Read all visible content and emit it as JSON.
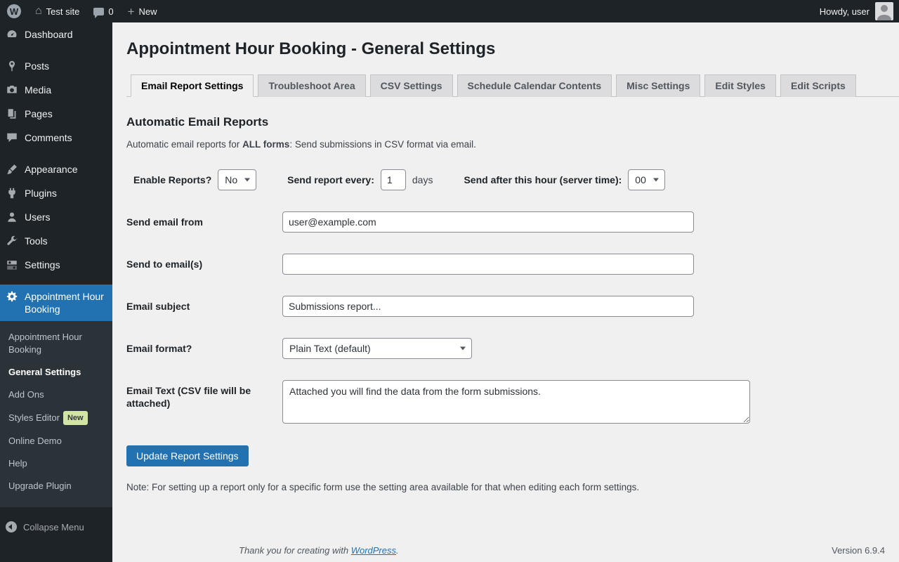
{
  "colors": {
    "accent": "#2271b1",
    "admin_bar_bg": "#1d2327",
    "sidebar_bg": "#1d2327",
    "submenu_bg": "#2c3338",
    "badge_bg": "#d3e5a4",
    "content_bg": "#f0f0f1"
  },
  "admin_bar": {
    "site_name": "Test site",
    "comments_count": "0",
    "new_label": "New",
    "howdy": "Howdy, user"
  },
  "sidebar": {
    "items": [
      {
        "label": "Dashboard",
        "icon": "dashboard-icon"
      },
      {
        "label": "Posts",
        "icon": "posts-pin-icon"
      },
      {
        "label": "Media",
        "icon": "media-camera-icon"
      },
      {
        "label": "Pages",
        "icon": "pages-icon"
      },
      {
        "label": "Comments",
        "icon": "comments-icon"
      },
      {
        "label": "Appearance",
        "icon": "appearance-brush-icon"
      },
      {
        "label": "Plugins",
        "icon": "plugins-plug-icon"
      },
      {
        "label": "Users",
        "icon": "users-icon"
      },
      {
        "label": "Tools",
        "icon": "tools-wrench-icon"
      },
      {
        "label": "Settings",
        "icon": "settings-sliders-icon"
      },
      {
        "label": "Appointment Hour Booking",
        "icon": "gear-icon",
        "active": true
      }
    ],
    "submenu": [
      {
        "label": "Appointment Hour Booking"
      },
      {
        "label": "General Settings",
        "current": true
      },
      {
        "label": "Add Ons"
      },
      {
        "label": "Styles Editor",
        "badge": "New"
      },
      {
        "label": "Online Demo"
      },
      {
        "label": "Help"
      },
      {
        "label": "Upgrade Plugin"
      }
    ],
    "collapse_label": "Collapse Menu"
  },
  "main": {
    "title": "Appointment Hour Booking - General Settings",
    "tabs": [
      {
        "label": "Email Report Settings",
        "active": true
      },
      {
        "label": "Troubleshoot Area"
      },
      {
        "label": "CSV Settings"
      },
      {
        "label": "Schedule Calendar Contents"
      },
      {
        "label": "Misc Settings"
      },
      {
        "label": "Edit Styles"
      },
      {
        "label": "Edit Scripts"
      }
    ],
    "section_title": "Automatic Email Reports",
    "intro": {
      "prefix": "Automatic email reports for ",
      "bold": "ALL forms",
      "suffix": ": Send submissions in CSV format via email."
    },
    "form": {
      "enable_reports": {
        "label": "Enable Reports?",
        "value": "No"
      },
      "send_every": {
        "label": "Send report every:",
        "value": "1",
        "suffix": "days"
      },
      "send_after": {
        "label": "Send after this hour (server time):",
        "value": "00"
      },
      "send_from": {
        "label": "Send email from",
        "value": "user@example.com"
      },
      "send_to": {
        "label": "Send to email(s)",
        "value": ""
      },
      "subject": {
        "label": "Email subject",
        "value": "Submissions report..."
      },
      "format": {
        "label": "Email format?",
        "value": "Plain Text (default)"
      },
      "email_text": {
        "label": "Email Text (CSV file will be attached)",
        "value": "Attached you will find the data from the form submissions."
      }
    },
    "update_button": "Update Report Settings",
    "note": "Note: For setting up a report only for a specific form use the setting area available for that when editing each form settings."
  },
  "footer": {
    "thanks_prefix": "Thank you for creating with ",
    "link": "WordPress",
    "suffix": ".",
    "version": "Version 6.9.4"
  }
}
